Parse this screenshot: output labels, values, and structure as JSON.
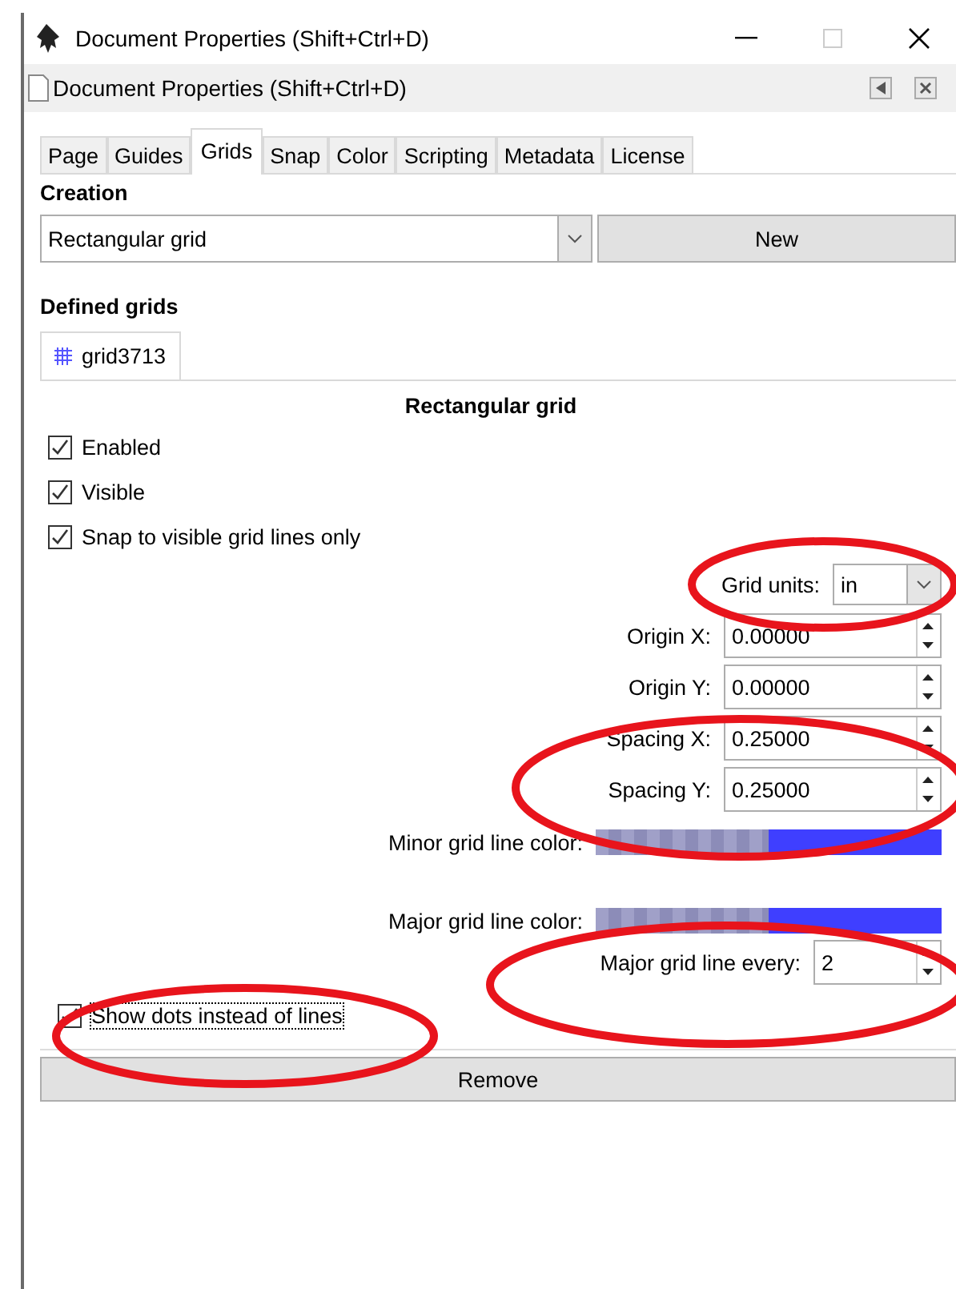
{
  "window": {
    "title": "Document Properties (Shift+Ctrl+D)"
  },
  "dock_panel": {
    "title": "Document Properties (Shift+Ctrl+D)"
  },
  "tabs": [
    {
      "label": "Page",
      "selected": false
    },
    {
      "label": "Guides",
      "selected": false
    },
    {
      "label": "Grids",
      "selected": true
    },
    {
      "label": "Snap",
      "selected": false
    },
    {
      "label": "Color",
      "selected": false
    },
    {
      "label": "Scripting",
      "selected": false
    },
    {
      "label": "Metadata",
      "selected": false
    },
    {
      "label": "License",
      "selected": false
    }
  ],
  "creation": {
    "heading": "Creation",
    "grid_type": "Rectangular grid",
    "new_button": "New"
  },
  "defined_grids": {
    "heading": "Defined grids",
    "grid_tabs": [
      {
        "label": "grid3713",
        "selected": true
      }
    ],
    "panel_title": "Rectangular grid",
    "checkboxes": [
      {
        "label": "Enabled",
        "checked": true
      },
      {
        "label": "Visible",
        "checked": true
      },
      {
        "label": "Snap to visible grid lines only",
        "checked": true
      }
    ],
    "grid_units": {
      "label": "Grid units:",
      "value": "in"
    },
    "spin_fields": [
      {
        "label": "Origin X:",
        "value": "0.00000"
      },
      {
        "label": "Origin Y:",
        "value": "0.00000"
      },
      {
        "label": "Spacing X:",
        "value": "0.25000"
      },
      {
        "label": "Spacing Y:",
        "value": "0.25000"
      }
    ],
    "color_swatches": [
      {
        "label": "Minor grid line color:",
        "color": "#3f3fff"
      },
      {
        "label": "Major grid line color:",
        "color": "#3f3fff"
      }
    ],
    "major_every": {
      "label": "Major grid line every:",
      "value": "2"
    },
    "show_dots": {
      "label": "Show dots instead of lines",
      "checked": true
    },
    "remove_button": "Remove"
  }
}
